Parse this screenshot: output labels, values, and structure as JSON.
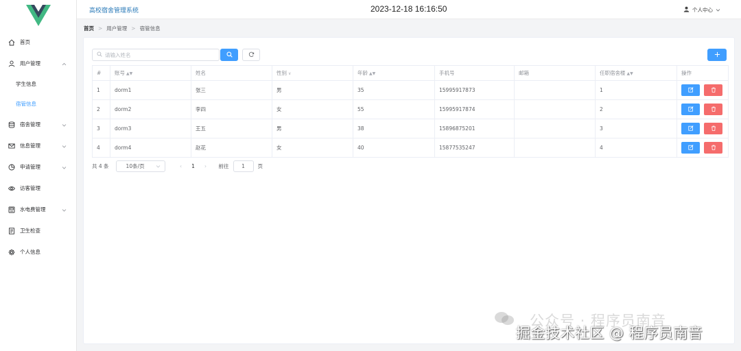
{
  "header": {
    "app_title": "高校宿舍管理系统",
    "datetime": "2023-12-18 16:16:50",
    "user_center": "个人中心"
  },
  "sidebar": {
    "items": [
      {
        "label": "首页",
        "icon": "home-icon"
      },
      {
        "label": "用户管理",
        "icon": "user-icon",
        "expanded": true,
        "children": [
          {
            "label": "学生信息"
          },
          {
            "label": "宿管信息",
            "active": true
          }
        ]
      },
      {
        "label": "宿舍管理",
        "icon": "database-icon"
      },
      {
        "label": "信息管理",
        "icon": "mail-icon"
      },
      {
        "label": "申请管理",
        "icon": "pie-chart-icon"
      },
      {
        "label": "访客管理",
        "icon": "eye-icon"
      },
      {
        "label": "水电费管理",
        "icon": "meter-icon"
      },
      {
        "label": "卫生检查",
        "icon": "document-icon"
      },
      {
        "label": "个人信息",
        "icon": "gear-icon"
      }
    ]
  },
  "breadcrumb": [
    "首页",
    "用户管理",
    "宿管信息"
  ],
  "search": {
    "placeholder": "请输入姓名",
    "value": ""
  },
  "table": {
    "columns": [
      "#",
      "账号",
      "姓名",
      "性别",
      "年龄",
      "手机号",
      "邮箱",
      "任职宿舍楼",
      "操作"
    ],
    "rows": [
      {
        "index": "1",
        "account": "dorm1",
        "name": "张三",
        "gender": "男",
        "age": "35",
        "phone": "15995917873",
        "email": "",
        "building": "1"
      },
      {
        "index": "2",
        "account": "dorm2",
        "name": "李四",
        "gender": "女",
        "age": "55",
        "phone": "15995917874",
        "email": "",
        "building": "2"
      },
      {
        "index": "3",
        "account": "dorm3",
        "name": "王五",
        "gender": "男",
        "age": "38",
        "phone": "15896875201",
        "email": "",
        "building": "3"
      },
      {
        "index": "4",
        "account": "dorm4",
        "name": "赵花",
        "gender": "女",
        "age": "40",
        "phone": "15877535247",
        "email": "",
        "building": "4"
      }
    ]
  },
  "pagination": {
    "total_text": "共 4 条",
    "page_size": "10条/页",
    "current_page": "1",
    "goto_label": "前往",
    "goto_value": "1",
    "page_suffix": "页"
  },
  "watermark": {
    "line1": "公众号 · 程序员南音",
    "line2": "掘金技术社区 @ 程序员南音"
  },
  "colors": {
    "primary": "#409eff",
    "danger": "#f56c6c",
    "title": "#2a7ab8",
    "logo_dark": "#35495e",
    "logo_green": "#41b883"
  }
}
